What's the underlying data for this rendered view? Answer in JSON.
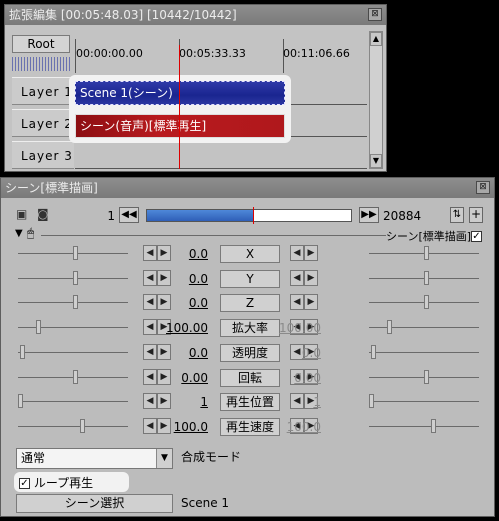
{
  "timeline": {
    "title": "拡張編集 [00:05:48.03] [10442/10442]",
    "close": "⊠",
    "root_label": "Root",
    "ruler_times": [
      "00:00:00.00",
      "00:05:33.33",
      "00:11:06.66"
    ],
    "layers": [
      "Layer  1",
      "Layer  2",
      "Layer  3"
    ],
    "clips": [
      {
        "label": "Scene 1(シーン)",
        "layer": 1,
        "color": "#1a2590"
      },
      {
        "label": "シーン(音声)[標準再生]",
        "layer": 2,
        "color": "#b0181c"
      }
    ]
  },
  "object": {
    "title": "シーン[標準描画]",
    "close": "⊠",
    "frame_start": "1",
    "frame_end": "20884",
    "seek_progress": 0.52,
    "effect_label": "シーン[標準描画]",
    "effect_checked": true,
    "params": [
      {
        "name": "X",
        "left": "0.0",
        "right": "",
        "link": false,
        "thumb_l": 0.52,
        "thumb_r": 0.52
      },
      {
        "name": "Y",
        "left": "0.0",
        "right": "",
        "link": false,
        "thumb_l": 0.52,
        "thumb_r": 0.52
      },
      {
        "name": "Z",
        "left": "0.0",
        "right": "",
        "link": false,
        "thumb_l": 0.52,
        "thumb_r": 0.52
      },
      {
        "name": "拡大率",
        "left": "100.00",
        "right": "100.00",
        "link": true,
        "thumb_l": 0.18,
        "thumb_r": 0.18
      },
      {
        "name": "透明度",
        "left": "0.0",
        "right": "0.0",
        "link": true,
        "thumb_l": 0.04,
        "thumb_r": 0.04
      },
      {
        "name": "回転",
        "left": "0.00",
        "right": "0.00",
        "link": true,
        "thumb_l": 0.52,
        "thumb_r": 0.52
      },
      {
        "name": "再生位置",
        "left": "1",
        "right": "1",
        "link": true,
        "thumb_l": 0.02,
        "thumb_r": 0.02
      },
      {
        "name": "再生速度",
        "left": "100.0",
        "right": "100.0",
        "link": true,
        "thumb_l": 0.58,
        "thumb_r": 0.58
      }
    ],
    "blend_value": "通常",
    "blend_label": "合成モード",
    "loop_label": "ループ再生",
    "loop_checked": true,
    "scene_button": "シーン選択",
    "scene_value": "Scene 1"
  }
}
